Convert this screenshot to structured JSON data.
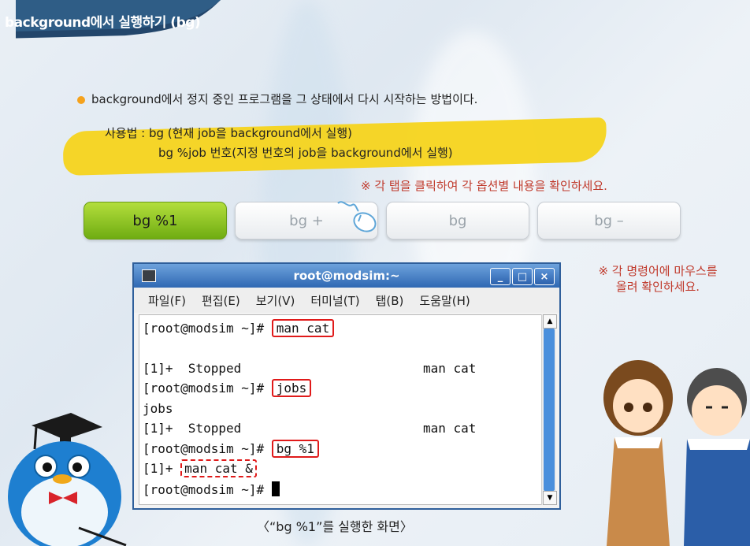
{
  "header": {
    "title": "background에서 실행하기 (bg)"
  },
  "intro": "background에서 정지 중인 프로그램을 그 상태에서 다시 시작하는 방법이다.",
  "usage": {
    "line1": "사용법 : bg (현재 job을 background에서 실행)",
    "line2": "bg %job 번호(지정 번호의 job을 background에서 실행)"
  },
  "hints": {
    "tabs": "※ 각 탭을 클릭하여 각 옵션별 내용을 확인하세요.",
    "commands_line1": "※ 각 명령어에 마우스를",
    "commands_line2": "올려 확인하세요."
  },
  "tabs": [
    {
      "label": "bg %1",
      "active": true
    },
    {
      "label": "bg +",
      "active": false
    },
    {
      "label": "bg",
      "active": false
    },
    {
      "label": "bg –",
      "active": false
    }
  ],
  "window": {
    "title": "root@modsim:~",
    "buttons": {
      "minimize": "_",
      "maximize": "□",
      "close": "×"
    },
    "menu": [
      "파일(F)",
      "편집(E)",
      "보기(V)",
      "터미널(T)",
      "탭(B)",
      "도움말(H)"
    ],
    "terminal": {
      "prompt": "[root@modsim ~]# ",
      "cmd1": "man cat",
      "stopped_prefix": "[1]+  Stopped",
      "stopped_cmd": "man cat",
      "cmd2": "jobs",
      "jobs_echo": "jobs",
      "cmd3": "bg %1",
      "bg_prefix": "[1]+ ",
      "bg_out": "man cat &"
    }
  },
  "caption": "〈“bg %1”를 실행한 화면〉",
  "colors": {
    "accent_green": "#8cc41e",
    "highlight_yellow": "#f5d41c",
    "title_blue": "#2f68b3",
    "hint_red": "#c0392b"
  }
}
